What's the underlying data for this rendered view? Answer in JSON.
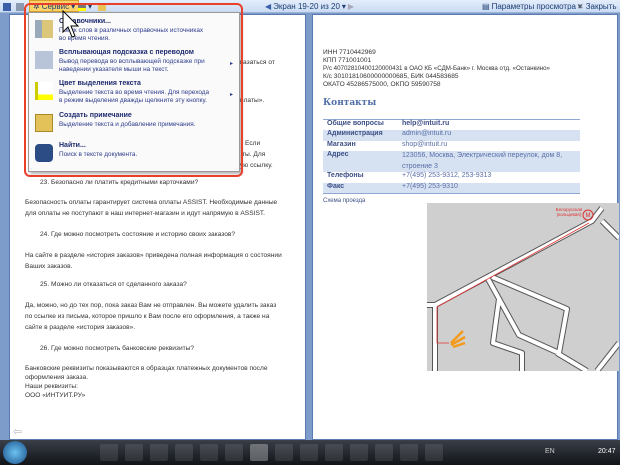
{
  "toolbar": {
    "service_label": "Сервис",
    "nav_label": "Экран 19-20 из 20",
    "view_options_label": "Параметры просмотра",
    "close_label": "Закрыть"
  },
  "menu": {
    "items": [
      {
        "title": "Справочники...",
        "desc": [
          "Поиск слов в различных справочных источниках",
          "во время чтения."
        ],
        "icon": "research-icon"
      },
      {
        "title": "Всплывающая подсказка с переводом",
        "desc": [
          "Вывод перевода во всплывающей подсказке при",
          "наведении указателя мыши на текст."
        ],
        "icon": "translate-icon"
      },
      {
        "title": "Цвет выделения текста",
        "desc": [
          "Выделение текста во время чтения. Для перехода",
          "в режим выделения дважды щелкните эту кнопку."
        ],
        "icon": "highlighter-icon"
      },
      {
        "title": "Создать примечание",
        "desc": [
          "Выделение текста и добавление примечания."
        ],
        "icon": "note-icon"
      },
      {
        "title": "Найти...",
        "desc": [
          "Поиск в тексте документа."
        ],
        "icon": "binoculars-icon"
      }
    ]
  },
  "left_page": {
    "fragments": [
      "казаться от",
      "платы».",
      "Если",
      "ты. Для",
      "ую ссылку."
    ],
    "q23": "23.   Безопасно ли платить кредитными карточками?",
    "a23": [
      "Безопасность оплаты гарантирует система оплаты ASSIST. Необходимые данные",
      "для оплаты не поступают в наш интернет-магазин и идут напрямую в ASSIST."
    ],
    "q24": "24.   Где можно посмотреть состояние и историю своих заказов?",
    "a24": [
      "На сайте в разделе «история заказов» приведена полная информация о состоянии",
      "Ваших заказов."
    ],
    "q25": "25.   Можно ли отказаться от сделанного заказа?",
    "a25": [
      "Да, можно, но до тех пор, пока заказ Вам не отправлен. Вы можете удалить заказ",
      "по ссылке из письма, которое пришло к Вам после его оформления, а также на",
      "сайте в разделе «история заказов»."
    ],
    "q26": "26.   Где можно посмотреть банковские реквизиты?",
    "a26": [
      "Банковские реквизиты показываются в образцах платежных документов после",
      "оформления заказа.",
      "Наши реквизиты:",
      "ООО «ИНТУИТ.РУ»"
    ]
  },
  "right_page": {
    "bank": [
      "ИНН 7710442969",
      "КПП 771001001",
      "Р/с 40702810400120000431 в ОАО КБ «СДМ-Банк» г. Москва отд. «Останкино»",
      "К/с 30101810600000000685, БИК 044583685",
      "ОКАТО 45286575000, ОКПО 59590758"
    ],
    "contacts_title": "Контакты",
    "contacts": [
      {
        "k": "Общие вопросы",
        "v": "help@intuit.ru"
      },
      {
        "k": "Администрация",
        "v": "admin@intuit.ru"
      },
      {
        "k": "Магазин",
        "v": "shop@intuit.ru"
      },
      {
        "k": "Адрес",
        "v": "123056, Москва, Электрический переулок, дом 8, строение 3"
      },
      {
        "k": "Телефоны",
        "v": "+7(495) 253-9312, 253-9313"
      },
      {
        "k": "Факс",
        "v": "+7(495) 253-9310"
      }
    ],
    "map_caption": "Схема проезда",
    "metro_label": "Белорусская (кольцевая)"
  },
  "taskbar": {
    "lang": "EN",
    "clock": "20:47"
  }
}
